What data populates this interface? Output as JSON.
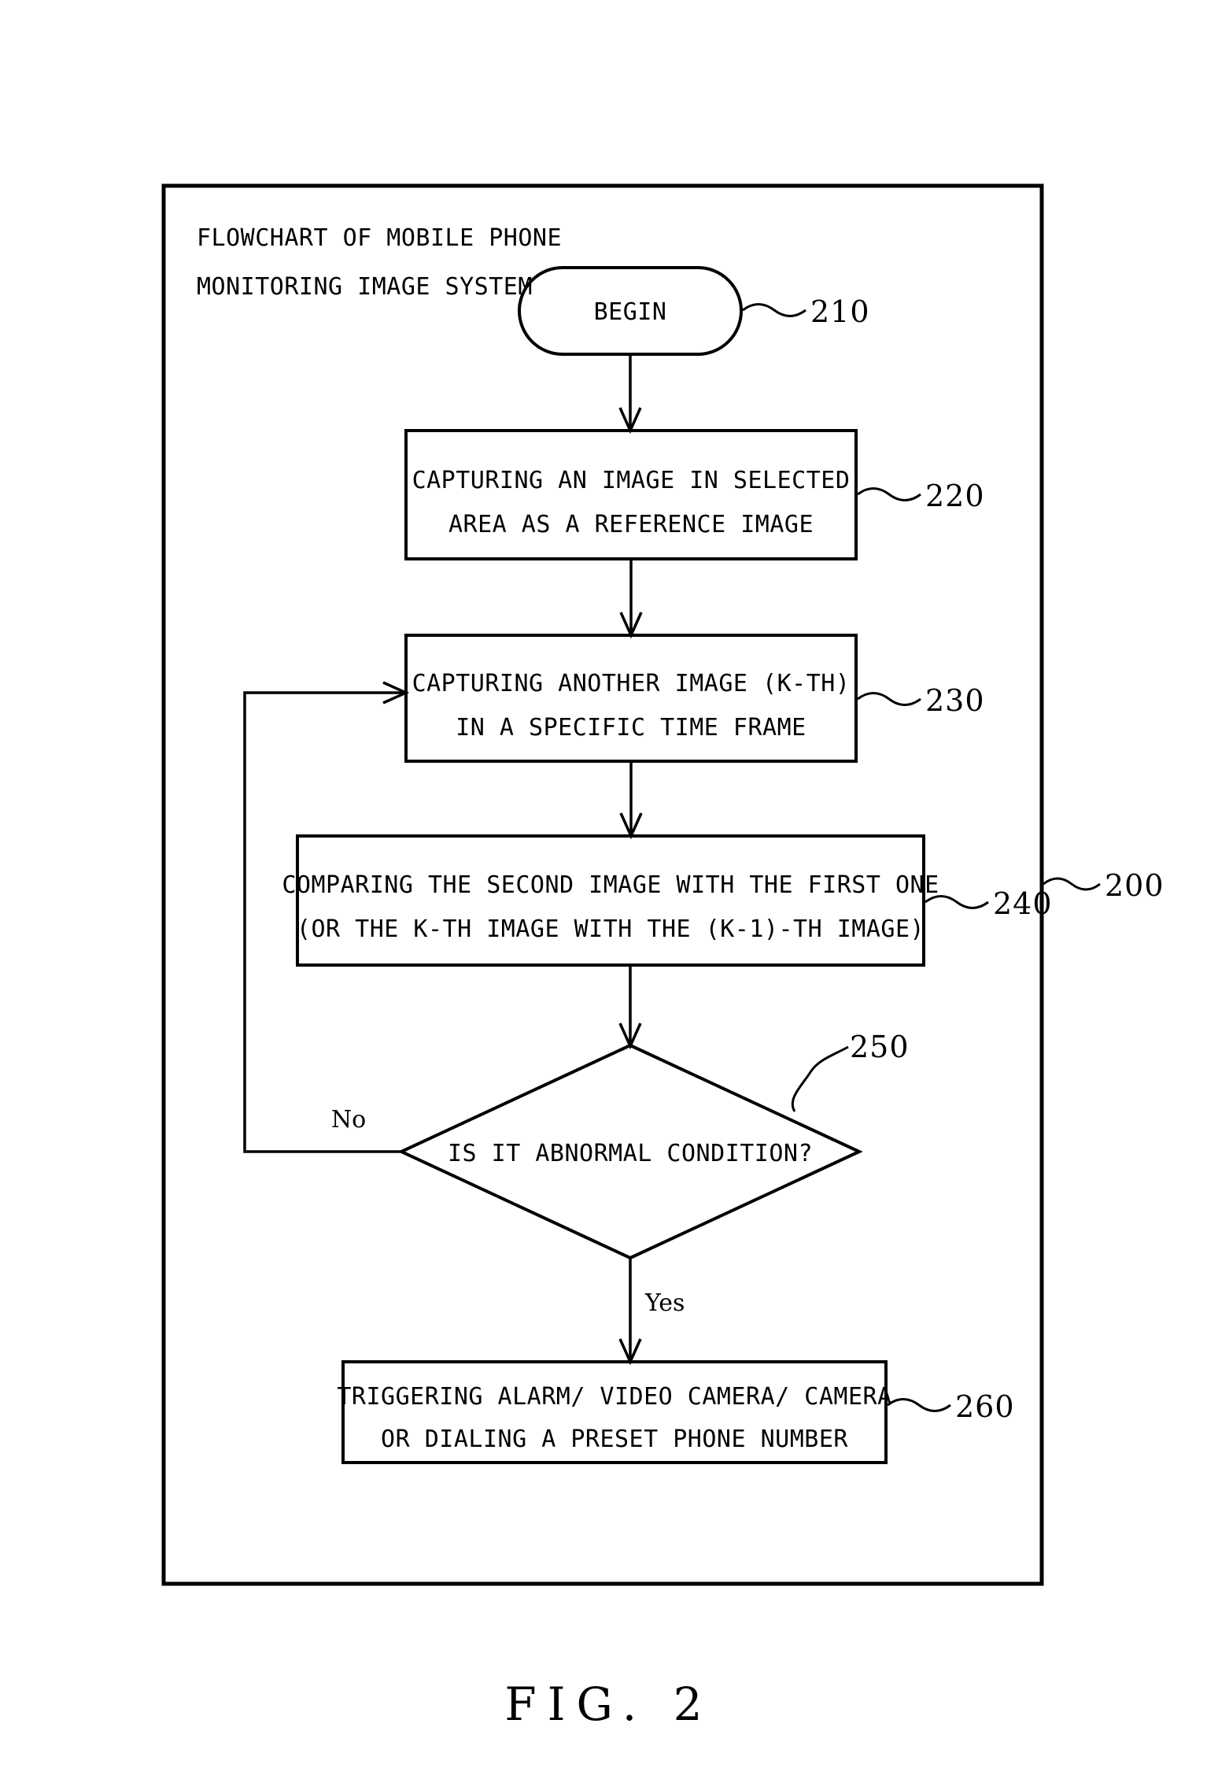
{
  "figure": {
    "caption": "FIG. 2",
    "outer_frame_ref": "200",
    "title_line1": "FLOWCHART OF MOBILE PHONE",
    "title_line2": "MONITORING IMAGE SYSTEM"
  },
  "nodes": [
    {
      "id": "begin",
      "shape": "stadium",
      "ref": "210",
      "lines": [
        "BEGIN"
      ]
    },
    {
      "id": "capture-reference",
      "shape": "rect",
      "ref": "220",
      "lines": [
        "CAPTURING AN IMAGE IN SELECTED",
        "AREA AS A REFERENCE IMAGE"
      ]
    },
    {
      "id": "capture-kth",
      "shape": "rect",
      "ref": "230",
      "lines": [
        "CAPTURING ANOTHER IMAGE (K-TH)",
        "IN A SPECIFIC TIME FRAME"
      ]
    },
    {
      "id": "compare-images",
      "shape": "rect",
      "ref": "240",
      "lines": [
        "COMPARING THE SECOND IMAGE WITH THE FIRST ONE",
        "(OR THE K-TH IMAGE WITH THE (K-1)-TH IMAGE)"
      ]
    },
    {
      "id": "abnormal-decision",
      "shape": "diamond",
      "ref": "250",
      "lines": [
        "IS IT ABNORMAL CONDITION?"
      ]
    },
    {
      "id": "trigger-alarm",
      "shape": "rect",
      "ref": "260",
      "lines": [
        "TRIGGERING ALARM/ VIDEO CAMERA/ CAMERA",
        "OR DIALING A PRESET PHONE NUMBER"
      ]
    }
  ],
  "edge_labels": {
    "no": "No",
    "yes": "Yes"
  },
  "colors": {
    "ink": "#000000",
    "paper": "#ffffff"
  }
}
